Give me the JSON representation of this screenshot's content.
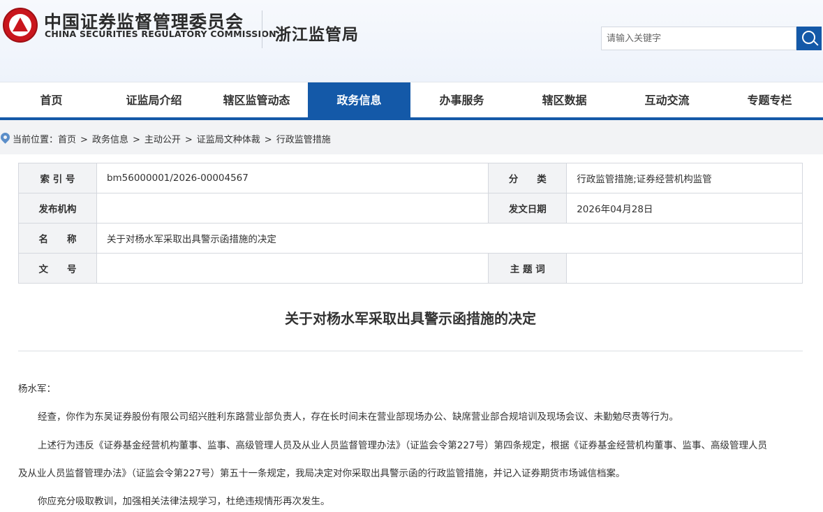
{
  "header": {
    "org_cn": "中国证券监督管理委员会",
    "org_en": "CHINA SECURITIES REGULATORY COMMISSION",
    "bureau": "浙江监管局",
    "search_placeholder": "请输入关键字"
  },
  "nav": {
    "items": [
      "首页",
      "证监局介绍",
      "辖区监管动态",
      "政务信息",
      "办事服务",
      "辖区数据",
      "互动交流",
      "专题专栏"
    ],
    "active_index": 3
  },
  "breadcrumb": {
    "prefix": "当前位置：",
    "items": [
      "首页",
      "政务信息",
      "主动公开",
      "证监局文种体裁",
      "行政监管措施"
    ],
    "separator": ">"
  },
  "meta": {
    "index_label": "索 引 号",
    "index_value": "bm56000001/2026-00004567",
    "category_label": "分　　类",
    "category_value": "行政监管措施;证券经营机构监管",
    "issuer_label": "发布机构",
    "issuer_value": "",
    "date_label": "发文日期",
    "date_value": "2026年04月28日",
    "name_label": "名　　称",
    "name_value": "关于对杨水军采取出具警示函措施的决定",
    "docno_label": "文　　号",
    "docno_value": "",
    "subject_label": "主 题 词",
    "subject_value": ""
  },
  "document": {
    "title": "关于对杨水军采取出具警示函措施的决定",
    "salutation": "杨水军：",
    "p1": "经查，你作为东吴证券股份有限公司绍兴胜利东路营业部负责人，存在长时间未在营业部现场办公、缺席营业部合规培训及现场会议、未勤勉尽责等行为。",
    "p2_line1": "上述行为违反《证券基金经营机构董事、监事、高级管理人员及从业人员监督管理办法》（证监会令第227号）第四条规定，根据《证券基金经营机构董事、监事、高级管理人员",
    "p2_line2": "及从业人员监督管理办法》（证监会令第227号）第五十一条规定，我局决定对你采取出具警示函的行政监管措施，并记入证券期货市场诚信档案。",
    "p3": "你应充分吸取教训，加强相关法律法规学习，杜绝违规情形再次发生。"
  },
  "colors": {
    "brand_blue": "#1459a8",
    "logo_red": "#c9161d"
  }
}
